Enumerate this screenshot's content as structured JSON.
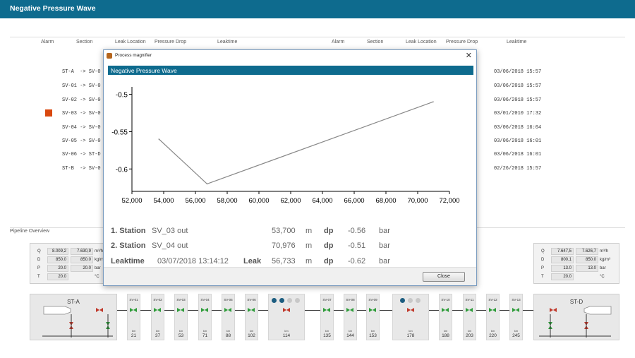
{
  "app": {
    "title": "Negative Pressure Wave"
  },
  "table": {
    "headers_left": [
      "Alarm",
      "Section",
      "Leak Location",
      "Pressure Drop",
      "Leaktime"
    ],
    "headers_right": [
      "Alarm",
      "Section",
      "Leak Location",
      "Pressure Drop",
      "Leaktime"
    ],
    "rows": [
      {
        "section": "ST-A  -> SV-0",
        "time": "03/06/2018 15:57"
      },
      {
        "section": "SV-01 -> SV-0",
        "time": "03/06/2018 15:57"
      },
      {
        "section": "SV-02 -> SV-0",
        "time": "03/06/2018 15:57"
      },
      {
        "section": "SV-03 -> SV-0",
        "time": "03/01/2010 17:32"
      },
      {
        "section": "SV-04 -> SV-0",
        "time": "03/06/2018 16:04"
      },
      {
        "section": "SV-05 -> SV-0",
        "time": "03/06/2018 16:01"
      },
      {
        "section": "SV-06 -> ST-D",
        "time": "03/06/2018 16:01"
      },
      {
        "section": "ST-B  -> SV-0",
        "time": "02/26/2018 15:57"
      }
    ]
  },
  "overview": {
    "label": "Pipeline Overview",
    "left_panel": {
      "rows": [
        {
          "label": "Q",
          "v1": "8.009,2",
          "v2": "7.630,9",
          "unit": "m³/h"
        },
        {
          "label": "D",
          "v1": "850.0",
          "v2": "850.0",
          "unit": "kg/m³"
        },
        {
          "label": "P",
          "v1": "20.0",
          "v2": "20.0",
          "unit": "bar"
        },
        {
          "label": "T",
          "v1": "20.0",
          "v2": "",
          "unit": "°C"
        }
      ]
    },
    "right_panel": {
      "rows": [
        {
          "label": "Q",
          "v1": "7.647,5",
          "v2": "7.626,7",
          "unit": "m³/h"
        },
        {
          "label": "D",
          "v1": "800.1",
          "v2": "850.0",
          "unit": "kg/m³"
        },
        {
          "label": "P",
          "v1": "13.0",
          "v2": "13.0",
          "unit": "bar"
        },
        {
          "label": "T",
          "v1": "20.0",
          "v2": "",
          "unit": "°C"
        }
      ]
    },
    "station_left": "ST-A",
    "station_right": "ST-D",
    "km_label": "km",
    "valves": [
      {
        "name": "SV-01",
        "km": "21"
      },
      {
        "name": "SV-02",
        "km": "37"
      },
      {
        "name": "SV-03",
        "km": "53"
      },
      {
        "name": "SV-04",
        "km": "71"
      },
      {
        "name": "SV-05",
        "km": "88"
      },
      {
        "name": "SV-06",
        "km": "102"
      },
      {
        "name": "",
        "km": "114"
      },
      {
        "name": "SV-07",
        "km": "135"
      },
      {
        "name": "SV-08",
        "km": "144"
      },
      {
        "name": "SV-09",
        "km": "153"
      },
      {
        "name": "",
        "km": "178"
      },
      {
        "name": "SV-10",
        "km": "188"
      },
      {
        "name": "SV-11",
        "km": "203"
      },
      {
        "name": "SV-12",
        "km": "220"
      },
      {
        "name": "SV-13",
        "km": "245"
      }
    ]
  },
  "dialog": {
    "title": "Process magnifier",
    "close_glyph": "✕",
    "header": "Negative Pressure Wave",
    "station1": {
      "label": "1. Station",
      "name": "SV_03 out",
      "pos": "53,700",
      "unit": "m",
      "dp_label": "dp",
      "dp": "-0.56",
      "dp_unit": "bar"
    },
    "station2": {
      "label": "2. Station",
      "name": "SV_04 out",
      "pos": "70,976",
      "unit": "m",
      "dp_label": "dp",
      "dp": "-0.51",
      "dp_unit": "bar"
    },
    "leak": {
      "label": "Leaktime",
      "time": "03/07/2018 13:14:12",
      "leak_label": "Leak",
      "pos": "56,733",
      "unit": "m",
      "dp_label": "dp",
      "dp": "-0.62",
      "dp_unit": "bar"
    },
    "close_button": "Close"
  },
  "chart_data": {
    "type": "line",
    "title": "",
    "xlabel": "",
    "ylabel": "",
    "x": [
      53700,
      56733,
      70976
    ],
    "y": [
      -0.56,
      -0.62,
      -0.51
    ],
    "xlim": [
      52000,
      72000
    ],
    "ylim": [
      -0.63,
      -0.49
    ],
    "xticks": [
      "52,000",
      "54,000",
      "56,000",
      "58,000",
      "60,000",
      "62,000",
      "64,000",
      "66,000",
      "68,000",
      "70,000",
      "72,000"
    ],
    "yticks": [
      "-0.5",
      "-0.55",
      "-0.6"
    ],
    "grid": false,
    "color": "#888888"
  }
}
